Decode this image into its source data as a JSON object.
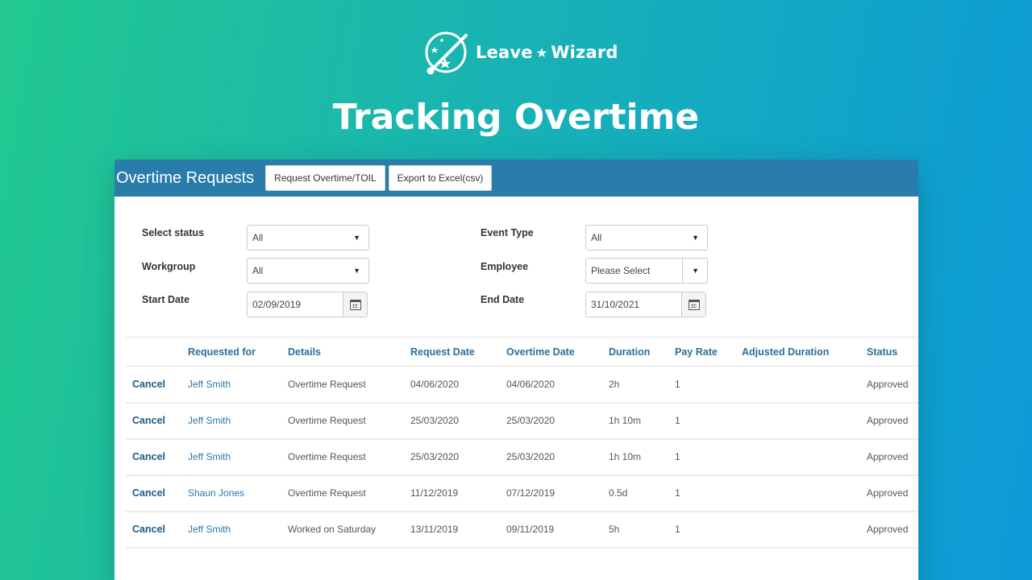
{
  "brand": {
    "name_left": "Leave",
    "name_right": "Wizard",
    "star": "★"
  },
  "headline": "Tracking Overtime",
  "panel": {
    "title": "Overtime Requests",
    "buttons": [
      "Request Overtime/TOIL",
      "Export to Excel(csv)"
    ]
  },
  "filters": {
    "status_label": "Select status",
    "status_value": "All",
    "workgroup_label": "Workgroup",
    "workgroup_value": "All",
    "start_label": "Start Date",
    "start_value": "02/09/2019",
    "event_label": "Event Type",
    "event_value": "All",
    "employee_label": "Employee",
    "employee_value": "Please Select",
    "end_label": "End Date",
    "end_value": "31/10/2021"
  },
  "table": {
    "headers": [
      "",
      "Requested for",
      "Details",
      "Request Date",
      "Overtime Date",
      "Duration",
      "Pay Rate",
      "Adjusted Duration",
      "Status"
    ],
    "rows": [
      [
        "Cancel",
        "Jeff Smith",
        "Overtime Request",
        "04/06/2020",
        "04/06/2020",
        "2h",
        "1",
        "",
        "Approved"
      ],
      [
        "Cancel",
        "Jeff Smith",
        "Overtime Request",
        "25/03/2020",
        "25/03/2020",
        "1h 10m",
        "1",
        "",
        "Approved"
      ],
      [
        "Cancel",
        "Jeff Smith",
        "Overtime Request",
        "25/03/2020",
        "25/03/2020",
        "1h 10m",
        "1",
        "",
        "Approved"
      ],
      [
        "Cancel",
        "Shaun Jones",
        "Overtime Request",
        "11/12/2019",
        "07/12/2019",
        "0.5d",
        "1",
        "",
        "Approved"
      ],
      [
        "Cancel",
        "Jeff Smith",
        "Worked on Saturday",
        "13/11/2019",
        "09/11/2019",
        "5h",
        "1",
        "",
        "Approved"
      ]
    ]
  },
  "colors": {
    "header_bar": "#2a7dab",
    "link": "#2a78a7",
    "bg_left": "#22c98f",
    "bg_right": "#0c9ad8"
  }
}
